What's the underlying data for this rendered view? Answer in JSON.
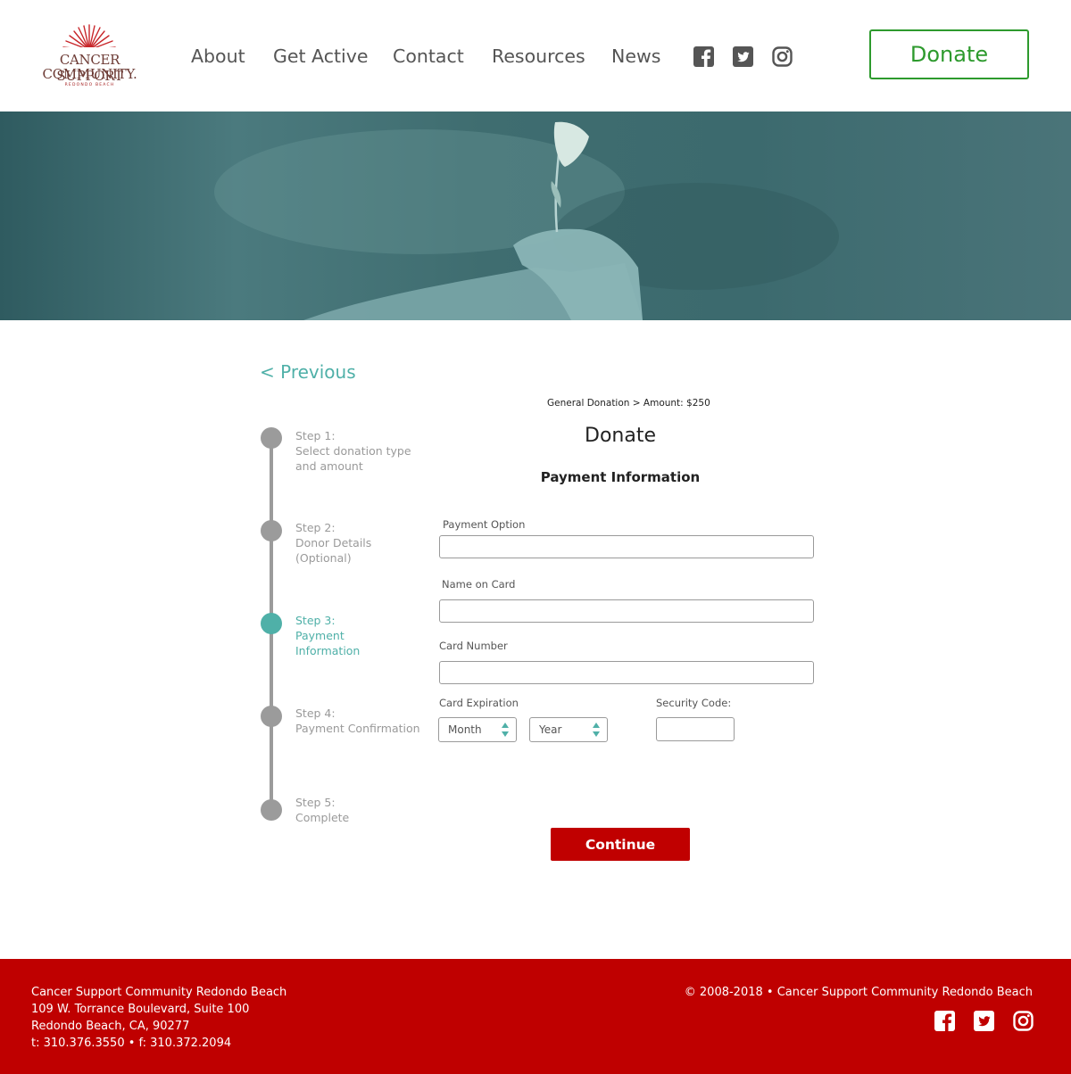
{
  "brand": {
    "logo_line1": "CANCER SUPPORT",
    "logo_line2": "COMMUNITY.",
    "logo_line3": "REDONDO BEACH",
    "accent_color": "#4fb0a8",
    "primary_red": "#c00000",
    "donate_green": "#2d9a2d"
  },
  "nav": {
    "items": [
      {
        "label": "About"
      },
      {
        "label": "Get Active"
      },
      {
        "label": "Contact"
      },
      {
        "label": "Resources"
      },
      {
        "label": "News"
      }
    ],
    "social_icons": [
      "facebook-icon",
      "twitter-icon",
      "instagram-icon"
    ],
    "donate_label": "Donate"
  },
  "hero": {
    "image": "hands-holding-flower-photo"
  },
  "content": {
    "previous_label": "< Previous",
    "breadcrumb": "General Donation  >  Amount: $250",
    "title": "Donate",
    "section_heading": "Payment Information"
  },
  "steps": [
    {
      "title": "Step 1:",
      "line1": "Select donation type",
      "line2": "and amount",
      "active": false
    },
    {
      "title": "Step 2:",
      "line1": "Donor Details",
      "line2": "(Optional)",
      "active": false
    },
    {
      "title": "Step 3:",
      "line1": "Payment",
      "line2": "Information",
      "active": true
    },
    {
      "title": "Step 4:",
      "line1": "Payment Confirmation",
      "line2": "",
      "active": false
    },
    {
      "title": "Step 5:",
      "line1": "Complete",
      "line2": "",
      "active": false
    }
  ],
  "form": {
    "payment_option_label": "Payment Option",
    "payment_option_value": "",
    "name_on_card_label": "Name on Card",
    "name_on_card_value": "",
    "card_number_label": "Card Number",
    "card_number_value": "",
    "card_expiration_label": "Card Expiration",
    "month_value": "Month",
    "year_value": "Year",
    "security_code_label": "Security Code:",
    "security_code_value": "",
    "continue_label": "Continue"
  },
  "footer": {
    "org_name": "Cancer Support Community Redondo Beach",
    "address1": "109 W. Torrance Boulevard, Suite 100",
    "address2": "Redondo Beach, CA, 90277",
    "phone_fax": "t: 310.376.3550 • f: 310.372.2094",
    "copyright": "© 2008-2018 • Cancer Support Community Redondo Beach",
    "social_icons": [
      "facebook-icon",
      "twitter-icon",
      "instagram-icon"
    ]
  }
}
